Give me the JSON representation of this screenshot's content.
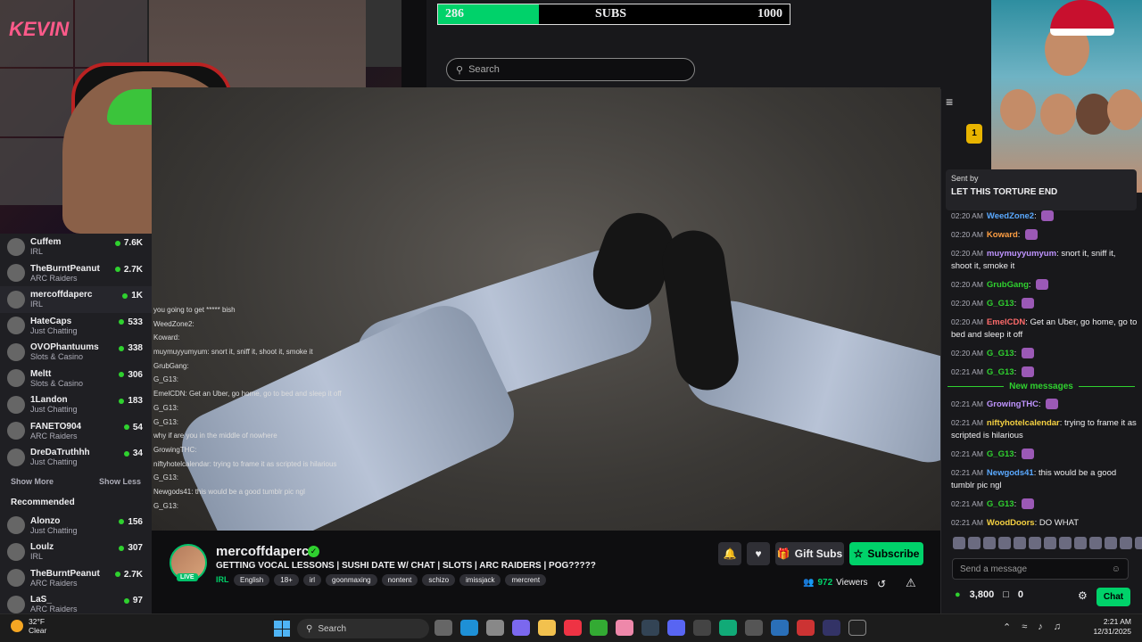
{
  "sub_goal": {
    "current": "286",
    "label": "SUBS",
    "target": "1000",
    "progress_fraction": 0.286
  },
  "search": {
    "placeholder": "Search"
  },
  "sidebar": {
    "channels": [
      {
        "name": "Cuffem",
        "game": "IRL",
        "viewers": "7.6K"
      },
      {
        "name": "TheBurntPeanut",
        "game": "ARC Raiders",
        "viewers": "2.7K"
      },
      {
        "name": "mercoffdaperc",
        "game": "IRL",
        "viewers": "1K"
      },
      {
        "name": "HateCaps",
        "game": "Just Chatting",
        "viewers": "533"
      },
      {
        "name": "OVOPhantuums",
        "game": "Slots & Casino",
        "viewers": "338"
      },
      {
        "name": "Meltt",
        "game": "Slots & Casino",
        "viewers": "306"
      },
      {
        "name": "1Landon",
        "game": "Just Chatting",
        "viewers": "183"
      },
      {
        "name": "FANETO904",
        "game": "ARC Raiders",
        "viewers": "54"
      },
      {
        "name": "DreDaTruthhh",
        "game": "Just Chatting",
        "viewers": "34"
      }
    ],
    "show_more": "Show More",
    "show_less": "Show Less",
    "recommended_heading": "Recommended",
    "recommended": [
      {
        "name": "Alonzo",
        "game": "Just Chatting",
        "viewers": "156"
      },
      {
        "name": "Loulz",
        "game": "IRL",
        "viewers": "307"
      },
      {
        "name": "TheBurntPeanut",
        "game": "ARC Raiders",
        "viewers": "2.7K"
      },
      {
        "name": "LaS_",
        "game": "ARC Raiders",
        "viewers": "97"
      }
    ]
  },
  "overlay_chat": [
    "you going to get ***** bish",
    "WeedZone2:",
    "Koward:",
    "muymuyyumyum: snort it, sniff it, shoot it, smoke it",
    "GrubGang:",
    "G_G13:",
    "EmelCDN: Get an Uber, go home, go to bed and sleep it off",
    "G_G13:",
    "G_G13:",
    "why if are you in the middle of nowhere",
    "GrowingTHC:",
    "niftyhotelcalendar: trying to frame it as scripted is hilarious",
    "G_G13:",
    "Newgods41: this would be a good tumblr pic ngl",
    "G_G13:"
  ],
  "stream": {
    "channel": "mercoffdaperc",
    "live": "LIVE",
    "title": "GETTING VOCAL LESSONS | SUSHI DATE W/ CHAT | SLOTS | ARC RAIDERS | POG?????",
    "category": "IRL",
    "tags": [
      "English",
      "18+",
      "irl",
      "goonmaxing",
      "nontent",
      "schizo",
      "imissjack",
      "mercrent"
    ],
    "gift_label": "Gift Subs",
    "subscribe_label": "Subscribe",
    "viewers": "972",
    "viewers_label": "Viewers"
  },
  "chat": {
    "pinned_sender": "Sent by",
    "pinned_message": "LET THIS TORTURE END",
    "rank_badge": "1",
    "messages": [
      {
        "time": "02:20 AM",
        "user": "WeedZone2",
        "text": "",
        "color": "nm5"
      },
      {
        "time": "02:20 AM",
        "user": "Koward",
        "text": "",
        "color": "nm4"
      },
      {
        "time": "02:20 AM",
        "user": "muymuyyumyum",
        "text": "snort it, sniff it, shoot it, smoke it",
        "color": "nm1"
      },
      {
        "time": "02:20 AM",
        "user": "GrubGang",
        "text": "",
        "color": "nm3"
      },
      {
        "time": "02:20 AM",
        "user": "G_G13",
        "text": "",
        "color": "nm3"
      },
      {
        "time": "02:20 AM",
        "user": "EmelCDN",
        "text": "Get an Uber, go home, go to bed and sleep it off",
        "color": "nm2"
      },
      {
        "time": "02:20 AM",
        "user": "G_G13",
        "text": "",
        "color": "nm3"
      },
      {
        "time": "02:21 AM",
        "user": "G_G13",
        "text": "",
        "color": "nm3"
      }
    ],
    "new_messages_label": "New messages",
    "new_messages": [
      {
        "time": "02:21 AM",
        "user": "GrowingTHC",
        "text": "",
        "color": "nm1"
      },
      {
        "time": "02:21 AM",
        "user": "niftyhotelcalendar",
        "text": "trying to frame it as scripted is hilarious",
        "color": "nm6"
      },
      {
        "time": "02:21 AM",
        "user": "G_G13",
        "text": "",
        "color": "nm3"
      },
      {
        "time": "02:21 AM",
        "user": "Newgods41",
        "text": "this would be a good tumblr pic ngl",
        "color": "nm5"
      },
      {
        "time": "02:21 AM",
        "user": "G_G13",
        "text": "",
        "color": "nm3"
      },
      {
        "time": "02:21 AM",
        "user": "WoodDoors",
        "text": "DO WHAT",
        "color": "nm6"
      }
    ],
    "input_placeholder": "Send a message",
    "points": "3,800",
    "drops": "0",
    "send_label": "Chat"
  },
  "taskbar": {
    "temp": "32°F",
    "condition": "Clear",
    "search_placeholder": "Search",
    "time": "2:21 AM",
    "date": "12/31/2025"
  },
  "colors": {
    "accent": "#00d26a",
    "bg": "#0e0e10",
    "panel": "#18181b"
  }
}
